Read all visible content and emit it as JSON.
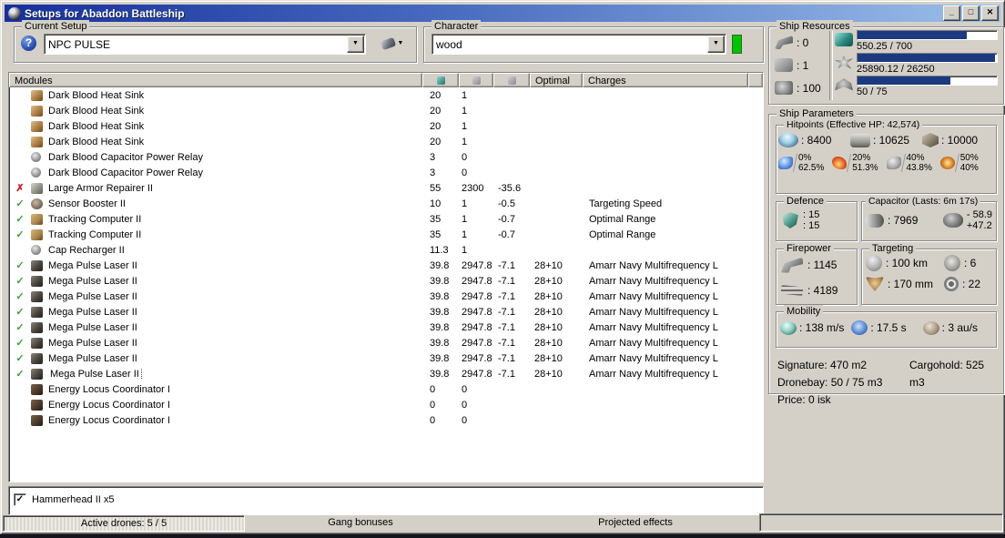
{
  "window": {
    "title": "Setups for Abaddon Battleship",
    "controls": {
      "minimize": "_",
      "maximize": "□",
      "close": "✕"
    }
  },
  "colors": {
    "titlebar_left": "#16309c",
    "titlebar_right": "#9cc0ea",
    "resource_bar_fill": "#1b3a80",
    "character_indicator_green": "#00c400",
    "check_green": "#3ca03c",
    "error_red": "#cc2020"
  },
  "current_setup": {
    "label": "Current Setup",
    "value": "NPC PULSE"
  },
  "character": {
    "label": "Character",
    "value": "wood"
  },
  "modules_table": {
    "headers": {
      "modules": "Modules",
      "optimal": "Optimal",
      "charges": "Charges"
    },
    "icon_columns": [
      "cpu-column-icon",
      "powergrid-column-icon",
      "capacitor-column-icon"
    ],
    "rows": [
      {
        "status": "",
        "icon": "heatsink",
        "name": "Dark Blood Heat Sink",
        "cpu": "20",
        "pg": "1",
        "cap": "",
        "optimal": "",
        "charge": ""
      },
      {
        "status": "",
        "icon": "heatsink",
        "name": "Dark Blood Heat Sink",
        "cpu": "20",
        "pg": "1",
        "cap": "",
        "optimal": "",
        "charge": ""
      },
      {
        "status": "",
        "icon": "heatsink",
        "name": "Dark Blood Heat Sink",
        "cpu": "20",
        "pg": "1",
        "cap": "",
        "optimal": "",
        "charge": ""
      },
      {
        "status": "",
        "icon": "heatsink",
        "name": "Dark Blood Heat Sink",
        "cpu": "20",
        "pg": "1",
        "cap": "",
        "optimal": "",
        "charge": ""
      },
      {
        "status": "",
        "icon": "caprelay",
        "name": "Dark Blood Capacitor Power Relay",
        "cpu": "3",
        "pg": "0",
        "cap": "",
        "optimal": "",
        "charge": ""
      },
      {
        "status": "",
        "icon": "caprelay",
        "name": "Dark Blood Capacitor Power Relay",
        "cpu": "3",
        "pg": "0",
        "cap": "",
        "optimal": "",
        "charge": ""
      },
      {
        "status": "x",
        "icon": "armorrep",
        "name": "Large Armor Repairer II",
        "cpu": "55",
        "pg": "2300",
        "cap": "-35.6",
        "optimal": "",
        "charge": ""
      },
      {
        "status": "ok",
        "icon": "sensor",
        "name": "Sensor Booster II",
        "cpu": "10",
        "pg": "1",
        "cap": "-0.5",
        "optimal": "",
        "charge": "Targeting Speed"
      },
      {
        "status": "ok",
        "icon": "tracking",
        "name": "Tracking Computer II",
        "cpu": "35",
        "pg": "1",
        "cap": "-0.7",
        "optimal": "",
        "charge": "Optimal Range"
      },
      {
        "status": "ok",
        "icon": "tracking",
        "name": "Tracking Computer II",
        "cpu": "35",
        "pg": "1",
        "cap": "-0.7",
        "optimal": "",
        "charge": "Optimal Range"
      },
      {
        "status": "",
        "icon": "caprelay",
        "name": "Cap Recharger II",
        "cpu": "11.3",
        "pg": "1",
        "cap": "",
        "optimal": "",
        "charge": ""
      },
      {
        "status": "ok",
        "icon": "laser",
        "name": "Mega Pulse Laser II",
        "cpu": "39.8",
        "pg": "2947.8",
        "cap": "-7.1",
        "optimal": "28+10",
        "charge": "Amarr Navy Multifrequency L"
      },
      {
        "status": "ok",
        "icon": "laser",
        "name": "Mega Pulse Laser II",
        "cpu": "39.8",
        "pg": "2947.8",
        "cap": "-7.1",
        "optimal": "28+10",
        "charge": "Amarr Navy Multifrequency L"
      },
      {
        "status": "ok",
        "icon": "laser",
        "name": "Mega Pulse Laser II",
        "cpu": "39.8",
        "pg": "2947.8",
        "cap": "-7.1",
        "optimal": "28+10",
        "charge": "Amarr Navy Multifrequency L"
      },
      {
        "status": "ok",
        "icon": "laser",
        "name": "Mega Pulse Laser II",
        "cpu": "39.8",
        "pg": "2947.8",
        "cap": "-7.1",
        "optimal": "28+10",
        "charge": "Amarr Navy Multifrequency L"
      },
      {
        "status": "ok",
        "icon": "laser",
        "name": "Mega Pulse Laser II",
        "cpu": "39.8",
        "pg": "2947.8",
        "cap": "-7.1",
        "optimal": "28+10",
        "charge": "Amarr Navy Multifrequency L"
      },
      {
        "status": "ok",
        "icon": "laser",
        "name": "Mega Pulse Laser II",
        "cpu": "39.8",
        "pg": "2947.8",
        "cap": "-7.1",
        "optimal": "28+10",
        "charge": "Amarr Navy Multifrequency L"
      },
      {
        "status": "ok",
        "icon": "laser",
        "name": "Mega Pulse Laser II",
        "cpu": "39.8",
        "pg": "2947.8",
        "cap": "-7.1",
        "optimal": "28+10",
        "charge": "Amarr Navy Multifrequency L"
      },
      {
        "status": "ok",
        "icon": "laser",
        "name": "Mega Pulse Laser II",
        "cpu": "39.8",
        "pg": "2947.8",
        "cap": "-7.1",
        "optimal": "28+10",
        "charge": "Amarr Navy Multifrequency L",
        "selected": true
      },
      {
        "status": "",
        "icon": "rig",
        "name": "Energy Locus Coordinator I",
        "cpu": "0",
        "pg": "0",
        "cap": "",
        "optimal": "",
        "charge": ""
      },
      {
        "status": "",
        "icon": "rig",
        "name": "Energy Locus Coordinator I",
        "cpu": "0",
        "pg": "0",
        "cap": "",
        "optimal": "",
        "charge": ""
      },
      {
        "status": "",
        "icon": "rig",
        "name": "Energy Locus Coordinator I",
        "cpu": "0",
        "pg": "0",
        "cap": "",
        "optimal": "",
        "charge": ""
      }
    ]
  },
  "drones": {
    "items": [
      {
        "checked": true,
        "label": "Hammerhead II x5"
      }
    ]
  },
  "statusbar": {
    "active_drones": "Active drones: 5 / 5",
    "gang_bonuses": "Gang bonuses",
    "projected_effects": "Projected effects"
  },
  "ship_resources": {
    "title": "Ship Resources",
    "slots": [
      {
        "icon": "turret-slots",
        "value": ": 0"
      },
      {
        "icon": "launcher-slots",
        "value": ": 1"
      },
      {
        "icon": "calibration-slots",
        "value": ": 100"
      }
    ],
    "bars": [
      {
        "icon": "cpu",
        "text": "550.25 / 700",
        "pct": 78.6
      },
      {
        "icon": "powergrid",
        "text": "25890.12 / 26250",
        "pct": 98.6
      },
      {
        "icon": "drone",
        "text": "50 / 75",
        "pct": 66.7
      }
    ]
  },
  "ship_parameters": {
    "title": "Ship Parameters",
    "hitpoints": {
      "title": "Hitpoints (Effective HP: 42,574)",
      "hp": [
        {
          "icon": "shield",
          "value": ": 8400"
        },
        {
          "icon": "armor",
          "value": ": 10625"
        },
        {
          "icon": "structure",
          "value": ": 10000"
        }
      ],
      "resists": [
        {
          "icon": "em",
          "shield": "0%",
          "armor": "62.5%"
        },
        {
          "icon": "thermal",
          "shield": "20%",
          "armor": "51.3%"
        },
        {
          "icon": "kinetic",
          "shield": "40%",
          "armor": "43.8%"
        },
        {
          "icon": "explosive",
          "shield": "50%",
          "armor": "40%"
        }
      ]
    },
    "defence": {
      "title": "Defence",
      "line1": ": 15",
      "line2": ": 15"
    },
    "capacitor": {
      "title": "Capacitor (Lasts: 6m 17s)",
      "amount": ": 7969",
      "drain": "- 58.9",
      "recharge": "+47.2"
    },
    "firepower": {
      "title": "Firepower",
      "rows": [
        {
          "icon": "fp-turret",
          "value": ": 1145"
        },
        {
          "icon": "dps",
          "value": ": 4189"
        }
      ]
    },
    "targeting": {
      "title": "Targeting",
      "cells": [
        {
          "icon": "range",
          "value": ": 100 km"
        },
        {
          "icon": "max-targets",
          "value": ": 6"
        },
        {
          "icon": "scan-res",
          "value": ": 170 mm"
        },
        {
          "icon": "sensor-strength",
          "value": ": 22"
        }
      ]
    },
    "mobility": {
      "title": "Mobility",
      "cells": [
        {
          "icon": "speed",
          "value": ": 138 m/s"
        },
        {
          "icon": "align",
          "value": ": 17.5 s"
        },
        {
          "icon": "warp",
          "value": ": 3 au/s"
        }
      ]
    },
    "stats": {
      "signature": "Signature: 470 m2",
      "cargohold": "Cargohold: 525 m3",
      "dronebay": "Dronebay: 50 / 75 m3",
      "price": "Price: 0 isk"
    }
  }
}
